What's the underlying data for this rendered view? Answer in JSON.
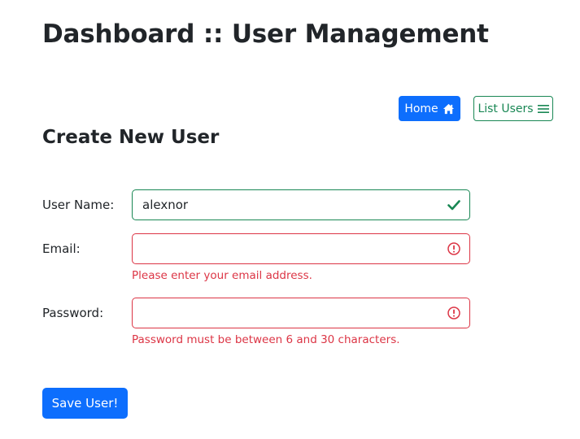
{
  "header": {
    "title": "Dashboard :: User Management"
  },
  "nav": {
    "home_label": "Home",
    "home_icon": "house-icon",
    "list_label": "List Users",
    "list_icon": "list-icon"
  },
  "form": {
    "title": "Create New User",
    "username": {
      "label": "User Name:",
      "value": "alexnor",
      "state": "valid",
      "state_icon": "check-icon"
    },
    "email": {
      "label": "Email:",
      "value": "",
      "state": "invalid",
      "state_icon": "exclamation-circle-icon",
      "error": "Please enter your email address."
    },
    "password": {
      "label": "Password:",
      "value": "",
      "state": "invalid",
      "state_icon": "exclamation-circle-icon",
      "error": "Password must be between 6 and 30 characters."
    },
    "submit_label": "Save User!"
  },
  "colors": {
    "primary": "#0d6efd",
    "success": "#198754",
    "danger": "#dc3545",
    "text": "#212529"
  }
}
